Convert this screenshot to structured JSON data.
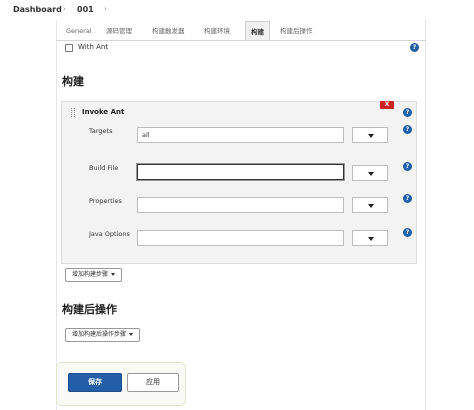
{
  "breadcrumb": {
    "items": [
      "Dashboard",
      "001"
    ],
    "separator": "›"
  },
  "tabs": [
    {
      "label": "General"
    },
    {
      "label": "源码管理"
    },
    {
      "label": "构建触发器"
    },
    {
      "label": "构建环境"
    },
    {
      "label": "构建",
      "active": true
    },
    {
      "label": "构建后操作"
    }
  ],
  "build_env": {
    "with_ant_label": "With Ant",
    "with_ant_checked": false
  },
  "build": {
    "section_title": "构建",
    "step": {
      "title": "Invoke Ant",
      "delete_label": "X",
      "fields": [
        {
          "label": "Targets",
          "value": "all"
        },
        {
          "label": "Build File",
          "value": ""
        },
        {
          "label": "Properties",
          "value": ""
        },
        {
          "label": "Java Options",
          "value": ""
        }
      ]
    },
    "add_step_label": "增加构建步骤"
  },
  "post_build": {
    "section_title": "构建后操作",
    "add_step_label": "增加构建后操作步骤"
  },
  "actions": {
    "save_label": "保存",
    "apply_label": "应用"
  },
  "help_icon_glyph": "?",
  "colors": {
    "primary": "#245ea8",
    "help": "#1f5ea8",
    "delete": "#cc2222"
  }
}
